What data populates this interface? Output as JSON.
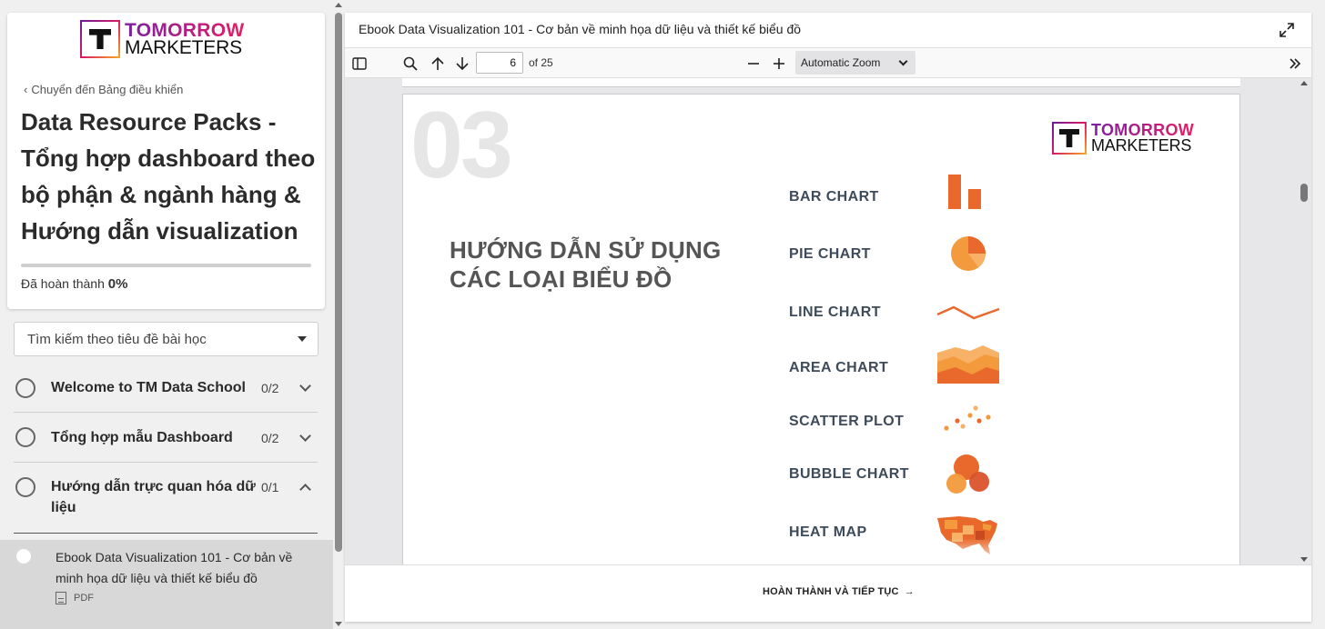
{
  "brand": {
    "line1": "TOMORROW",
    "line2": "MARKETERS"
  },
  "sidebar": {
    "back_link": "Chuyển đến Bảng điều khiển",
    "course_title": "Data Resource Packs - Tổng hợp dashboard theo bộ phận & ngành hàng & Hướng dẫn visualization",
    "progress_label": "Đã hoàn thành",
    "progress_value": "0%",
    "progress_fraction": 0,
    "search_placeholder": "Tìm kiếm theo tiêu đề bài học",
    "sections": [
      {
        "title": "Welcome to TM Data School",
        "count": "0/2",
        "expanded": false
      },
      {
        "title": "Tổng hợp mẫu Dashboard",
        "count": "0/2",
        "expanded": false
      },
      {
        "title": "Hướng dẫn trực quan hóa dữ liệu",
        "count": "0/1",
        "expanded": true
      }
    ],
    "current_lesson": {
      "title": "Ebook Data Visualization 101 - Cơ bản về minh họa dữ liệu và thiết kế biểu đồ",
      "type": "PDF"
    }
  },
  "main": {
    "title": "Ebook Data Visualization 101 - Cơ bản về minh họa dữ liệu và thiết kế biểu đồ",
    "toolbar": {
      "page_number": "6",
      "page_total": "of 25",
      "zoom": "Automatic Zoom"
    },
    "slide": {
      "number": "03",
      "heading_line1": "HƯỚNG DẪN SỬ DỤNG",
      "heading_line2": "CÁC LOẠI BIỂU ĐỒ",
      "chart_types": [
        "BAR CHART",
        "PIE CHART",
        "LINE CHART",
        "AREA CHART",
        "SCATTER PLOT",
        "BUBBLE CHART",
        "HEAT MAP"
      ],
      "accent_colors": [
        "#e8692b",
        "#f39a3c",
        "#f7b267"
      ]
    },
    "footer_button": "HOÀN THÀNH VÀ TIẾP TỤC",
    "footer_arrow": "→"
  }
}
